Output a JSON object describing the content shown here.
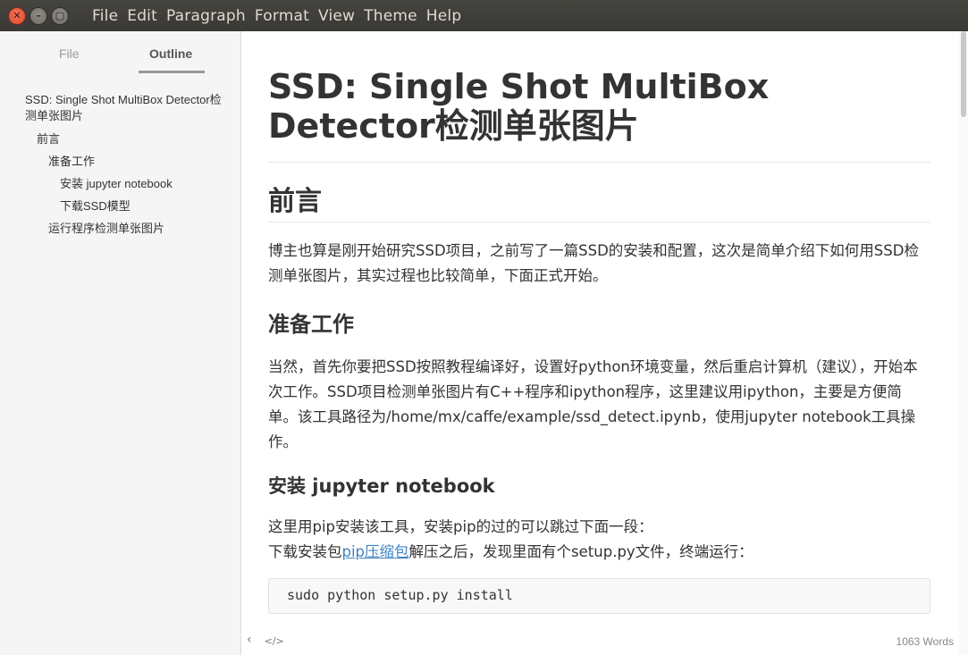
{
  "window": {
    "controls": [
      "close",
      "minimize",
      "maximize"
    ]
  },
  "menu": [
    "File",
    "Edit",
    "Paragraph",
    "Format",
    "View",
    "Theme",
    "Help"
  ],
  "sidebar": {
    "tabs": {
      "file": "File",
      "outline": "Outline",
      "active": "Outline"
    },
    "outline": [
      "SSD: Single Shot MultiBox Detector检测单张图片",
      "前言",
      "准备工作",
      "安装 jupyter notebook",
      "下载SSD模型",
      "运行程序检测单张图片"
    ]
  },
  "footer": {
    "word_count": "1063 Words"
  },
  "document": {
    "h1": "SSD: Single Shot MultiBox Detector检测单张图片",
    "h2": "前言",
    "p1": "博主也算是刚开始研究SSD项目，之前写了一篇SSD的安装和配置，这次是简单介绍下如何用SSD检测单张图片，其实过程也比较简单，下面正式开始。",
    "h3": "准备工作",
    "p2": "当然，首先你要把SSD按照教程编译好，设置好python环境变量，然后重启计算机（建议），开始本次工作。SSD项目检测单张图片有C++程序和ipython程序，这里建议用ipython，主要是方便简单。该工具路径为/home/mx/caffe/example/ssd_detect.ipynb，使用jupyter notebook工具操作。",
    "h4": "安装 jupyter notebook",
    "p3_line1": "这里用pip安装该工具，安装pip的过的可以跳过下面一段：",
    "p3_line2_pre": "下载安装包",
    "p3_link": "pip压缩包",
    "p3_line2_post": "解压之后，发现里面有个setup.py文件，终端运行：",
    "code": "sudo python setup.py install"
  },
  "colors": {
    "titlebar": "#3c3b37",
    "sidebar_bg": "#f5f5f5",
    "link": "#4183c4",
    "close_button": "#e5533a"
  }
}
